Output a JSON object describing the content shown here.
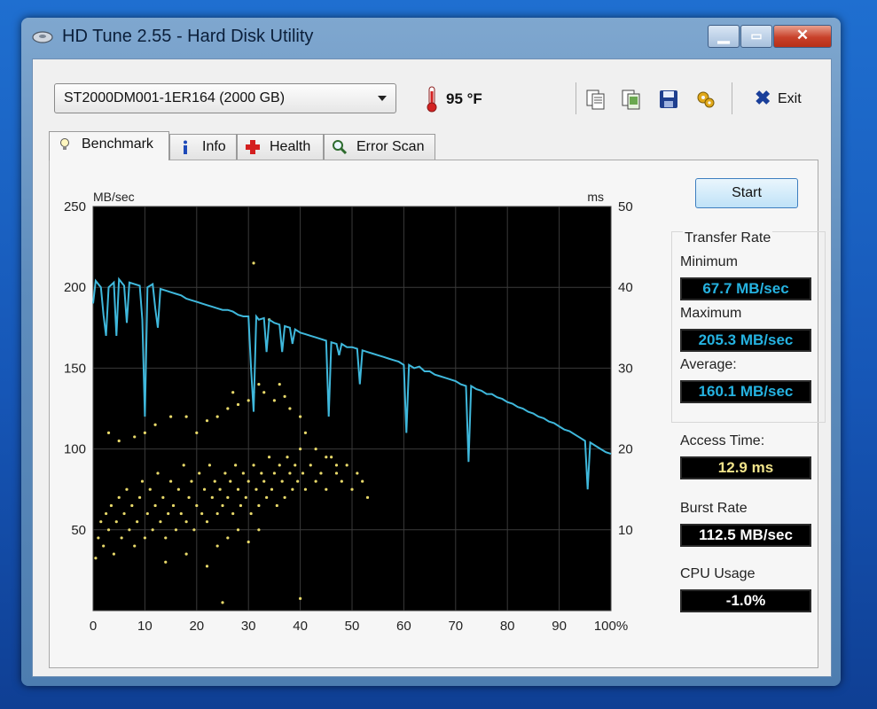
{
  "window": {
    "title": "HD Tune 2.55 - Hard Disk Utility"
  },
  "toolbar": {
    "drive": "ST2000DM001-1ER164 (2000 GB)",
    "temperature": "95 °F",
    "icons": [
      "copy-text-icon",
      "copy-screenshot-icon",
      "save-icon",
      "options-icon"
    ],
    "exit_label": "Exit"
  },
  "tabs": [
    {
      "label": "Benchmark",
      "icon": "bulb-icon",
      "active": true
    },
    {
      "label": "Info",
      "icon": "info-icon",
      "active": false
    },
    {
      "label": "Health",
      "icon": "health-cross-icon",
      "active": false
    },
    {
      "label": "Error Scan",
      "icon": "magnifier-icon",
      "active": false
    }
  ],
  "benchmark": {
    "start_label": "Start",
    "transfer_rate_title": "Transfer Rate",
    "minimum_label": "Minimum",
    "minimum_value": "67.7 MB/sec",
    "maximum_label": "Maximum",
    "maximum_value": "205.3 MB/sec",
    "average_label": "Average:",
    "average_value": "160.1 MB/sec",
    "access_time_label": "Access Time:",
    "access_time_value": "12.9 ms",
    "burst_rate_label": "Burst Rate",
    "burst_rate_value": "112.5 MB/sec",
    "cpu_usage_label": "CPU Usage",
    "cpu_usage_value": "-1.0%"
  },
  "colors": {
    "transfer_line": "#3fb8dc",
    "access_dots": "#e8d96a",
    "plot_bg": "#000000",
    "grid": "#3a3a3a"
  },
  "chart_data": {
    "type": "line",
    "ylabel": "MB/sec",
    "y2label": "ms",
    "xlim": [
      0,
      100
    ],
    "ylim": [
      0,
      250
    ],
    "y2lim": [
      0,
      50
    ],
    "x_ticks": [
      "0",
      "10",
      "20",
      "30",
      "40",
      "50",
      "60",
      "70",
      "80",
      "90",
      "100%"
    ],
    "y_ticks": [
      "250",
      "200",
      "150",
      "100",
      "50"
    ],
    "y2_ticks": [
      "50",
      "40",
      "30",
      "20",
      "10"
    ],
    "grid": true,
    "series": [
      {
        "kind": "transfer_rate",
        "points": [
          [
            0,
            190
          ],
          [
            0.5,
            204
          ],
          [
            1.5,
            200
          ],
          [
            2,
            183
          ],
          [
            2.5,
            170
          ],
          [
            3,
            200
          ],
          [
            4,
            203
          ],
          [
            4.5,
            170
          ],
          [
            5,
            205
          ],
          [
            6,
            201
          ],
          [
            6.5,
            178
          ],
          [
            7,
            203
          ],
          [
            8,
            202
          ],
          [
            9,
            201
          ],
          [
            9.5,
            180
          ],
          [
            10,
            120
          ],
          [
            10.5,
            200
          ],
          [
            11.5,
            202
          ],
          [
            12,
            187
          ],
          [
            12.5,
            175
          ],
          [
            13,
            199
          ],
          [
            14,
            198
          ],
          [
            15,
            197
          ],
          [
            16,
            196
          ],
          [
            17,
            195
          ],
          [
            18,
            193
          ],
          [
            19,
            192
          ],
          [
            20,
            191
          ],
          [
            21,
            190
          ],
          [
            22,
            189
          ],
          [
            23,
            188
          ],
          [
            24,
            187
          ],
          [
            25,
            186
          ],
          [
            26,
            186
          ],
          [
            27,
            185
          ],
          [
            28,
            183
          ],
          [
            29,
            182
          ],
          [
            30,
            182
          ],
          [
            30.5,
            150
          ],
          [
            31,
            123
          ],
          [
            31.5,
            182
          ],
          [
            32,
            180
          ],
          [
            33,
            181
          ],
          [
            33.5,
            160
          ],
          [
            34,
            180
          ],
          [
            35,
            178
          ],
          [
            36,
            177
          ],
          [
            36.5,
            160
          ],
          [
            37,
            176
          ],
          [
            38,
            175
          ],
          [
            38.5,
            165
          ],
          [
            39,
            174
          ],
          [
            40,
            172
          ],
          [
            41,
            171
          ],
          [
            42,
            170
          ],
          [
            43,
            169
          ],
          [
            44,
            168
          ],
          [
            45,
            167
          ],
          [
            45.5,
            120
          ],
          [
            46,
            166
          ],
          [
            47,
            165
          ],
          [
            47.5,
            158
          ],
          [
            48,
            165
          ],
          [
            49,
            163
          ],
          [
            50,
            163
          ],
          [
            51,
            162
          ],
          [
            51.5,
            140
          ],
          [
            52,
            161
          ],
          [
            53,
            160
          ],
          [
            54,
            159
          ],
          [
            55,
            158
          ],
          [
            56,
            157
          ],
          [
            57,
            156
          ],
          [
            58,
            155
          ],
          [
            59,
            154
          ],
          [
            60,
            152
          ],
          [
            60.5,
            110
          ],
          [
            61,
            152
          ],
          [
            62,
            150
          ],
          [
            63,
            151
          ],
          [
            64,
            148
          ],
          [
            65,
            148
          ],
          [
            66,
            146
          ],
          [
            67,
            145
          ],
          [
            68,
            144
          ],
          [
            69,
            143
          ],
          [
            70,
            142
          ],
          [
            71,
            140
          ],
          [
            72,
            139
          ],
          [
            72.5,
            92
          ],
          [
            73,
            139
          ],
          [
            74,
            137
          ],
          [
            75,
            136
          ],
          [
            76,
            134
          ],
          [
            77,
            134
          ],
          [
            78,
            132
          ],
          [
            79,
            131
          ],
          [
            80,
            129
          ],
          [
            81,
            128
          ],
          [
            82,
            126
          ],
          [
            83,
            125
          ],
          [
            84,
            123
          ],
          [
            85,
            122
          ],
          [
            86,
            120
          ],
          [
            87,
            119
          ],
          [
            88,
            117
          ],
          [
            89,
            116
          ],
          [
            90,
            114
          ],
          [
            91,
            112
          ],
          [
            92,
            111
          ],
          [
            93,
            109
          ],
          [
            94,
            107
          ],
          [
            95,
            105
          ],
          [
            95.5,
            75
          ],
          [
            96,
            104
          ],
          [
            97,
            102
          ],
          [
            98,
            100
          ],
          [
            99,
            98
          ],
          [
            100,
            97
          ]
        ]
      },
      {
        "kind": "access_time_ms",
        "points": [
          [
            0.5,
            6.5
          ],
          [
            1,
            9
          ],
          [
            1.5,
            11
          ],
          [
            2,
            8
          ],
          [
            2.5,
            12
          ],
          [
            3,
            10
          ],
          [
            3.5,
            13
          ],
          [
            4,
            7
          ],
          [
            4.5,
            11
          ],
          [
            5,
            14
          ],
          [
            5.5,
            9
          ],
          [
            6,
            12
          ],
          [
            6.5,
            15
          ],
          [
            7,
            10
          ],
          [
            7.5,
            13
          ],
          [
            8,
            8
          ],
          [
            8.5,
            11
          ],
          [
            9,
            14
          ],
          [
            9.5,
            16
          ],
          [
            10,
            9
          ],
          [
            10.5,
            12
          ],
          [
            11,
            15
          ],
          [
            11.5,
            10
          ],
          [
            12,
            13
          ],
          [
            12.5,
            17
          ],
          [
            13,
            11
          ],
          [
            13.5,
            14
          ],
          [
            14,
            9
          ],
          [
            14.5,
            12
          ],
          [
            15,
            16
          ],
          [
            15.5,
            13
          ],
          [
            16,
            10
          ],
          [
            16.5,
            15
          ],
          [
            17,
            12
          ],
          [
            17.5,
            18
          ],
          [
            18,
            11
          ],
          [
            18.5,
            14
          ],
          [
            19,
            16
          ],
          [
            19.5,
            10
          ],
          [
            20,
            13
          ],
          [
            20.5,
            17
          ],
          [
            21,
            12
          ],
          [
            21.5,
            15
          ],
          [
            22,
            11
          ],
          [
            22.5,
            18
          ],
          [
            23,
            14
          ],
          [
            23.5,
            16
          ],
          [
            24,
            12
          ],
          [
            24.5,
            15
          ],
          [
            25,
            13
          ],
          [
            25.5,
            17
          ],
          [
            26,
            14
          ],
          [
            26.5,
            16
          ],
          [
            27,
            12
          ],
          [
            27.5,
            18
          ],
          [
            28,
            15
          ],
          [
            28.5,
            13
          ],
          [
            29,
            17
          ],
          [
            29.5,
            14
          ],
          [
            30,
            16
          ],
          [
            30.5,
            12
          ],
          [
            31,
            18
          ],
          [
            31.5,
            15
          ],
          [
            32,
            13
          ],
          [
            32.5,
            17
          ],
          [
            33,
            16
          ],
          [
            33.5,
            14
          ],
          [
            34,
            19
          ],
          [
            34.5,
            15
          ],
          [
            35,
            17
          ],
          [
            35.5,
            13
          ],
          [
            36,
            18
          ],
          [
            36.5,
            16
          ],
          [
            37,
            14
          ],
          [
            37.5,
            19
          ],
          [
            38,
            17
          ],
          [
            38.5,
            15
          ],
          [
            39,
            18
          ],
          [
            39.5,
            16
          ],
          [
            40,
            20
          ],
          [
            40.5,
            17
          ],
          [
            41,
            15
          ],
          [
            42,
            18
          ],
          [
            43,
            16
          ],
          [
            44,
            17
          ],
          [
            45,
            15
          ],
          [
            46,
            19
          ],
          [
            47,
            17
          ],
          [
            48,
            16
          ],
          [
            49,
            18
          ],
          [
            50,
            15
          ],
          [
            51,
            17
          ],
          [
            52,
            16
          ],
          [
            53,
            14
          ],
          [
            3,
            22
          ],
          [
            5,
            21
          ],
          [
            8,
            21.5
          ],
          [
            10,
            22
          ],
          [
            12,
            23
          ],
          [
            15,
            24
          ],
          [
            18,
            24
          ],
          [
            20,
            22
          ],
          [
            22,
            23.5
          ],
          [
            24,
            24
          ],
          [
            26,
            25
          ],
          [
            27,
            27
          ],
          [
            28,
            25.5
          ],
          [
            30,
            26
          ],
          [
            31,
            27
          ],
          [
            32,
            28
          ],
          [
            33,
            27
          ],
          [
            35,
            26
          ],
          [
            36,
            28
          ],
          [
            37,
            26.5
          ],
          [
            38,
            25
          ],
          [
            40,
            24
          ],
          [
            41,
            22
          ],
          [
            43,
            20
          ],
          [
            45,
            19
          ],
          [
            47,
            18
          ],
          [
            14,
            6
          ],
          [
            18,
            7
          ],
          [
            22,
            5.5
          ],
          [
            24,
            8
          ],
          [
            26,
            9
          ],
          [
            28,
            10
          ],
          [
            30,
            8.5
          ],
          [
            32,
            10
          ],
          [
            25,
            1
          ],
          [
            31,
            43
          ],
          [
            34,
            36
          ],
          [
            40,
            1.5
          ]
        ]
      }
    ]
  }
}
